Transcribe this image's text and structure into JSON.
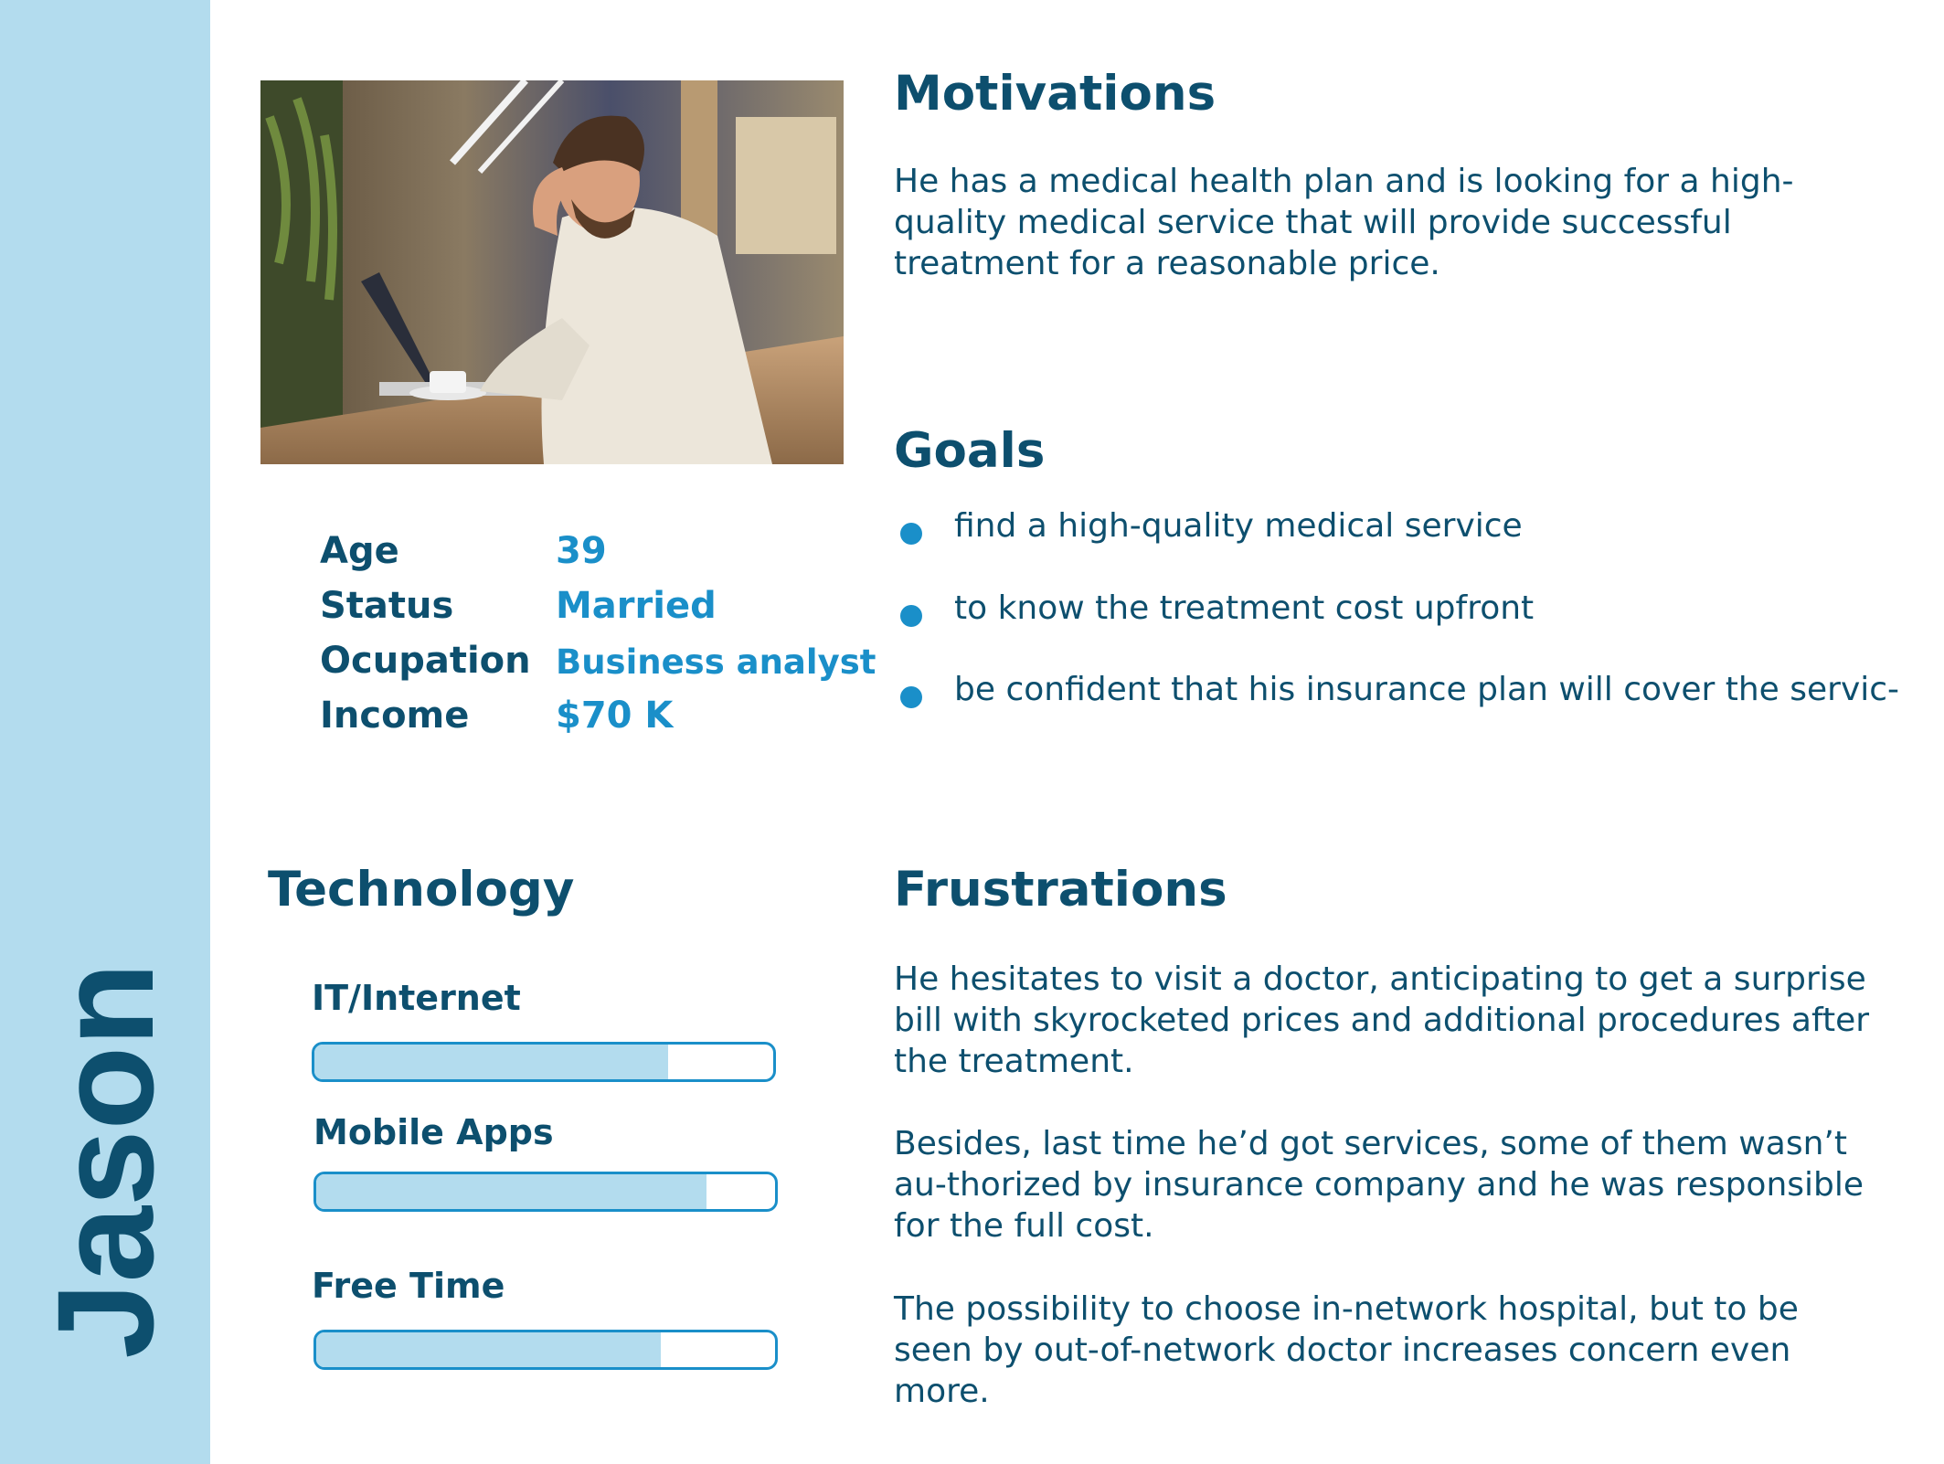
{
  "persona": {
    "name": "Jason"
  },
  "facts": [
    {
      "label": "Age",
      "value": "39"
    },
    {
      "label": "Status",
      "value": "Married"
    },
    {
      "label": "Ocupation",
      "value": "Business analyst"
    },
    {
      "label": "Income",
      "value": "$70 K"
    }
  ],
  "motivations": {
    "title": "Motivations",
    "text": "He has a medical health plan and is looking for a high-quality medical service that will provide successful treatment for a reasonable price."
  },
  "goals": {
    "title": "Goals",
    "items": [
      "find a high-quality medical service",
      "to know the treatment cost upfront",
      "be confident that his insurance plan will cover the servic-"
    ]
  },
  "technology": {
    "title": "Technology",
    "skills": [
      {
        "label": "IT/Internet",
        "level": 0.77
      },
      {
        "label": "Mobile Apps",
        "level": 0.85
      },
      {
        "label": "Free Time",
        "level": 0.75
      }
    ]
  },
  "frustrations": {
    "title": "Frustrations",
    "paragraphs": [
      "He hesitates to visit a doctor, anticipating to get a surprise bill with skyrocketed prices and additional procedures after the treatment.",
      "Besides, last time he’d got services, some of them wasn’t au-thorized by insurance company and he was responsible for the full cost.",
      "The possibility to choose in-network hospital, but to be seen by out-of-network doctor increases concern even more."
    ]
  },
  "colors": {
    "sidebar": "#b3dcee",
    "heading": "#0d4f6e",
    "accent": "#1a8fc9"
  }
}
